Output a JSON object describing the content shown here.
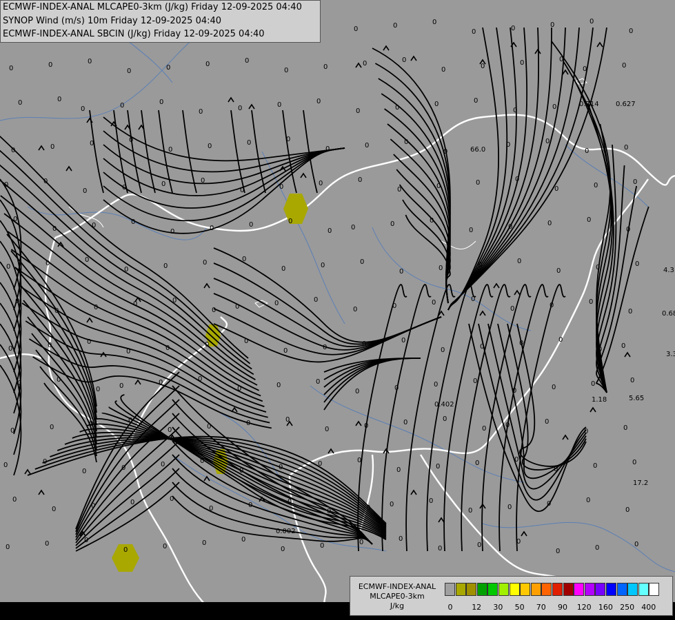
{
  "header": {
    "line1": "ECMWF-INDEX-ANAL MLCAPE0-3km (J/kg) Friday 12-09-2025 04:40",
    "line2": "SYNOP Wind (m/s) 10m Friday 12-09-2025 04:40",
    "line3": "ECMWF-INDEX-ANAL SBCIN (J/kg) Friday 12-09-2025 04:40"
  },
  "legend": {
    "title1": "ECMWF-INDEX-ANAL",
    "title2": "MLCAPE0-3km",
    "unit": "J/kg",
    "colors": [
      "#a0a0a0",
      "#a8a800",
      "#a09000",
      "#00a000",
      "#00c800",
      "#a0f000",
      "#ffff00",
      "#ffc800",
      "#ffa000",
      "#ff6400",
      "#e01e00",
      "#a00000",
      "#ff00ff",
      "#b400ff",
      "#7800ff",
      "#0000ff",
      "#0064ff",
      "#00c8ff",
      "#64ffff",
      "#ffffff"
    ],
    "ticks": [
      "0",
      "12",
      "30",
      "50",
      "70",
      "90",
      "120",
      "160",
      "250",
      "400"
    ]
  },
  "map_labels": {
    "cin_values": [
      "0.714",
      "0.627",
      "66.0",
      "4.3",
      "0.68",
      "3.3",
      "1.18",
      "5.65",
      "0.402",
      "17.2",
      "0.002"
    ],
    "zero_value": "0"
  }
}
